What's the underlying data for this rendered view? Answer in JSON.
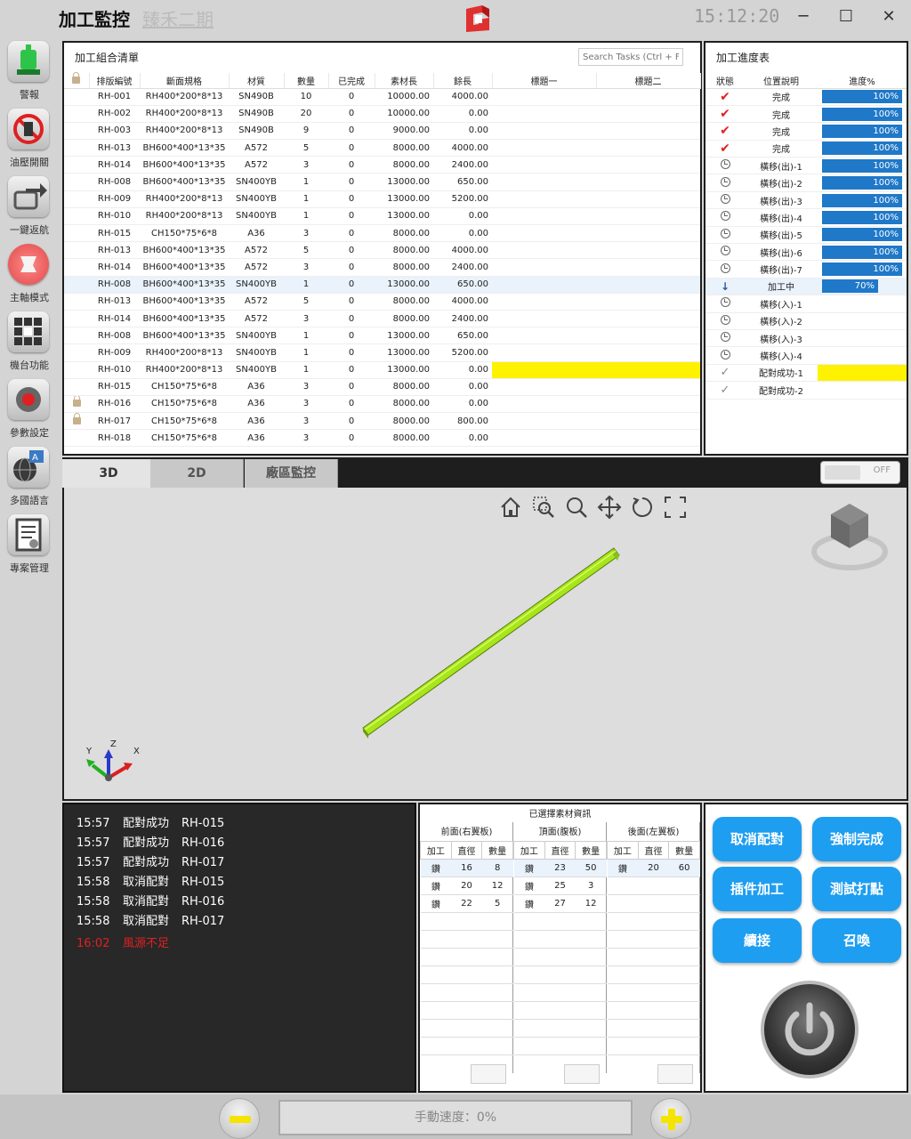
{
  "window": {
    "title": "加工監控",
    "project": "臻禾二期",
    "clock": "15:12:20",
    "minimize_label": "─",
    "maximize_label": "☐",
    "close_label": "✕"
  },
  "sidebar": {
    "items": [
      {
        "label": "警報",
        "icon": "alarm-light-icon"
      },
      {
        "label": "油壓開關",
        "icon": "hydraulic-switch-icon"
      },
      {
        "label": "一鍵返航",
        "icon": "return-home-icon"
      },
      {
        "label": "主軸模式",
        "icon": "spindle-mode-icon"
      },
      {
        "label": "機台功能",
        "icon": "machine-functions-icon"
      },
      {
        "label": "參數設定",
        "icon": "parameter-settings-icon"
      },
      {
        "label": "多國語言",
        "icon": "language-icon"
      },
      {
        "label": "專案管理",
        "icon": "project-management-icon"
      }
    ]
  },
  "task_list": {
    "title": "加工組合清單",
    "search_placeholder": "Search Tasks (Ctrl + F)",
    "columns": [
      "排版編號",
      "斷面規格",
      "材質",
      "數量",
      "已完成",
      "素材長",
      "餘長",
      "標題一",
      "標題二"
    ],
    "rows": [
      [
        "RH-001",
        "RH400*200*8*13",
        "SN490B",
        "10",
        "0",
        "10000.00",
        "4000.00",
        "",
        ""
      ],
      [
        "RH-002",
        "RH400*200*8*13",
        "SN490B",
        "20",
        "0",
        "10000.00",
        "0.00",
        "",
        ""
      ],
      [
        "RH-003",
        "RH400*200*8*13",
        "SN490B",
        "9",
        "0",
        "9000.00",
        "0.00",
        "",
        ""
      ],
      [
        "RH-013",
        "BH600*400*13*35",
        "A572",
        "5",
        "0",
        "8000.00",
        "4000.00",
        "",
        ""
      ],
      [
        "RH-014",
        "BH600*400*13*35",
        "A572",
        "3",
        "0",
        "8000.00",
        "2400.00",
        "",
        ""
      ],
      [
        "RH-008",
        "BH600*400*13*35",
        "SN400YB",
        "1",
        "0",
        "13000.00",
        "650.00",
        "",
        ""
      ],
      [
        "RH-009",
        "RH400*200*8*13",
        "SN400YB",
        "1",
        "0",
        "13000.00",
        "5200.00",
        "",
        ""
      ],
      [
        "RH-010",
        "RH400*200*8*13",
        "SN400YB",
        "1",
        "0",
        "13000.00",
        "0.00",
        "",
        ""
      ],
      [
        "RH-015",
        "CH150*75*6*8",
        "A36",
        "3",
        "0",
        "8000.00",
        "0.00",
        "",
        ""
      ],
      [
        "RH-013",
        "BH600*400*13*35",
        "A572",
        "5",
        "0",
        "8000.00",
        "4000.00",
        "",
        ""
      ],
      [
        "RH-014",
        "BH600*400*13*35",
        "A572",
        "3",
        "0",
        "8000.00",
        "2400.00",
        "",
        ""
      ],
      [
        "RH-008",
        "BH600*400*13*35",
        "SN400YB",
        "1",
        "0",
        "13000.00",
        "650.00",
        "",
        ""
      ],
      [
        "RH-013",
        "BH600*400*13*35",
        "A572",
        "5",
        "0",
        "8000.00",
        "4000.00",
        "",
        ""
      ],
      [
        "RH-014",
        "BH600*400*13*35",
        "A572",
        "3",
        "0",
        "8000.00",
        "2400.00",
        "",
        ""
      ],
      [
        "RH-008",
        "BH600*400*13*35",
        "SN400YB",
        "1",
        "0",
        "13000.00",
        "650.00",
        "",
        ""
      ],
      [
        "RH-009",
        "RH400*200*8*13",
        "SN400YB",
        "1",
        "0",
        "13000.00",
        "5200.00",
        "",
        ""
      ],
      [
        "RH-010",
        "RH400*200*8*13",
        "SN400YB",
        "1",
        "0",
        "13000.00",
        "0.00",
        "",
        ""
      ],
      [
        "RH-015",
        "CH150*75*6*8",
        "A36",
        "3",
        "0",
        "8000.00",
        "0.00",
        "",
        ""
      ],
      [
        "RH-016",
        "CH150*75*6*8",
        "A36",
        "3",
        "0",
        "8000.00",
        "0.00",
        "",
        ""
      ],
      [
        "RH-017",
        "CH150*75*6*8",
        "A36",
        "3",
        "0",
        "8000.00",
        "800.00",
        "",
        ""
      ],
      [
        "RH-018",
        "CH150*75*6*8",
        "A36",
        "3",
        "0",
        "8000.00",
        "0.00",
        "",
        ""
      ]
    ],
    "selected_row": 11,
    "highlight_row": 16,
    "locked_rows": [
      18,
      19
    ]
  },
  "progress": {
    "title": "加工進度表",
    "columns": [
      "狀態",
      "位置說明",
      "進度%"
    ],
    "rows": [
      {
        "status": "done",
        "status_icon": "checkmark-icon",
        "label": "完成",
        "percent": "100%",
        "fill": 1.0
      },
      {
        "status": "done",
        "status_icon": "checkmark-icon",
        "label": "完成",
        "percent": "100%",
        "fill": 1.0
      },
      {
        "status": "done",
        "status_icon": "checkmark-icon",
        "label": "完成",
        "percent": "100%",
        "fill": 1.0
      },
      {
        "status": "done",
        "status_icon": "checkmark-icon",
        "label": "完成",
        "percent": "100%",
        "fill": 1.0
      },
      {
        "status": "pending",
        "status_icon": "clock-icon",
        "label": "橫移(出)-1",
        "percent": "100%",
        "fill": 1.0
      },
      {
        "status": "pending",
        "status_icon": "clock-icon",
        "label": "橫移(出)-2",
        "percent": "100%",
        "fill": 1.0
      },
      {
        "status": "pending",
        "status_icon": "clock-icon",
        "label": "橫移(出)-3",
        "percent": "100%",
        "fill": 1.0
      },
      {
        "status": "pending",
        "status_icon": "clock-icon",
        "label": "橫移(出)-4",
        "percent": "100%",
        "fill": 1.0
      },
      {
        "status": "pending",
        "status_icon": "clock-icon",
        "label": "橫移(出)-5",
        "percent": "100%",
        "fill": 1.0
      },
      {
        "status": "pending",
        "status_icon": "clock-icon",
        "label": "橫移(出)-6",
        "percent": "100%",
        "fill": 1.0
      },
      {
        "status": "pending",
        "status_icon": "clock-icon",
        "label": "橫移(出)-7",
        "percent": "100%",
        "fill": 1.0
      },
      {
        "status": "active",
        "status_icon": "down-arrow-icon",
        "label": "加工中",
        "percent": "70%",
        "fill": 0.7
      },
      {
        "status": "pending",
        "status_icon": "clock-icon",
        "label": "橫移(入)-1",
        "percent": "",
        "fill": 0
      },
      {
        "status": "pending",
        "status_icon": "clock-icon",
        "label": "橫移(入)-2",
        "percent": "",
        "fill": 0
      },
      {
        "status": "pending",
        "status_icon": "clock-icon",
        "label": "橫移(入)-3",
        "percent": "",
        "fill": 0
      },
      {
        "status": "pending",
        "status_icon": "clock-icon",
        "label": "橫移(入)-4",
        "percent": "",
        "fill": 0
      },
      {
        "status": "matched",
        "status_icon": "check-gray-icon",
        "label": "配對成功-1",
        "percent": "",
        "fill": 0,
        "highlight": true
      },
      {
        "status": "matched",
        "status_icon": "check-gray-icon",
        "label": "配對成功-2",
        "percent": "",
        "fill": 0
      }
    ]
  },
  "view_tabs": {
    "tabs": [
      "3D",
      "2D",
      "廠區監控"
    ],
    "active": 0,
    "toggle_label": "OFF"
  },
  "viewport": {
    "axes": {
      "x": "X",
      "y": "Y",
      "z": "Z"
    },
    "tools": [
      "home-icon",
      "zoom-window-icon",
      "zoom-icon",
      "pan-icon",
      "rotate-icon",
      "fullscreen-icon"
    ]
  },
  "log": {
    "entries": [
      {
        "time": "15:57",
        "msg": "配對成功",
        "id": "RH-015",
        "level": "info"
      },
      {
        "time": "15:57",
        "msg": "配對成功",
        "id": "RH-016",
        "level": "info"
      },
      {
        "time": "15:57",
        "msg": "配對成功",
        "id": "RH-017",
        "level": "info"
      },
      {
        "time": "15:58",
        "msg": "取消配對",
        "id": "RH-015",
        "level": "info"
      },
      {
        "time": "15:58",
        "msg": "取消配對",
        "id": "RH-016",
        "level": "info"
      },
      {
        "time": "15:58",
        "msg": "取消配對",
        "id": "RH-017",
        "level": "info"
      },
      {
        "time": "16:02",
        "msg": "風源不足",
        "id": "",
        "level": "error"
      }
    ]
  },
  "material": {
    "title": "已選擇素材資訊",
    "col_headers": [
      "加工",
      "直徑",
      "數量"
    ],
    "groups": [
      {
        "name": "前面(右翼板)",
        "rows": [
          [
            "鑽",
            "16",
            "8"
          ],
          [
            "鑽",
            "20",
            "12"
          ],
          [
            "鑽",
            "22",
            "5"
          ]
        ]
      },
      {
        "name": "頂面(腹板)",
        "rows": [
          [
            "鑽",
            "23",
            "50"
          ],
          [
            "鑽",
            "25",
            "3"
          ],
          [
            "鑽",
            "27",
            "12"
          ]
        ]
      },
      {
        "name": "後面(左翼板)",
        "rows": [
          [
            "鑽",
            "20",
            "60"
          ]
        ]
      }
    ]
  },
  "actions": {
    "cancel_match": "取消配對",
    "force_complete": "強制完成",
    "insert_process": "插件加工",
    "test_mark": "測試打點",
    "continue": "續接",
    "summon": "召喚"
  },
  "speed": {
    "label": "手動速度：0%"
  }
}
